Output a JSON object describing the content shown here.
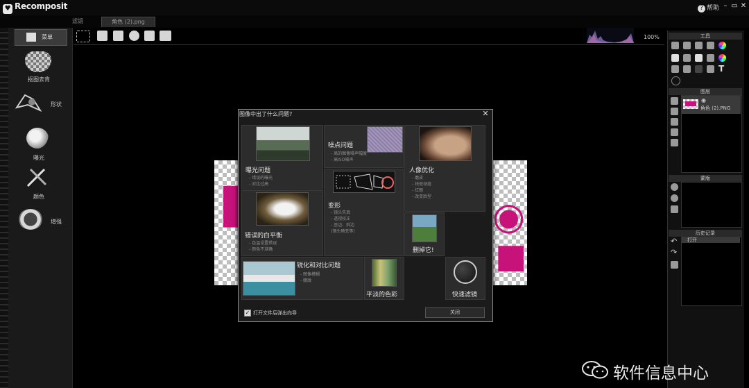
{
  "app": {
    "logo": "Recomposit",
    "help": "帮助",
    "window_controls": [
      "–",
      "▭",
      "✕"
    ]
  },
  "tabs": {
    "filters": "滤镜",
    "file": "角色 (2).png"
  },
  "toolbar": {
    "icons": [
      "zoom-icon",
      "save-icon",
      "export-icon",
      "info-icon",
      "add-image-icon",
      "print-icon"
    ],
    "zoom": "100%"
  },
  "sidebar": {
    "menu": "菜单",
    "items": [
      {
        "label": "抠图去背",
        "icon": "cutout-heart-icon"
      },
      {
        "label": "形状",
        "icon": "shape-icon"
      },
      {
        "label": "曝光",
        "icon": "exposure-icon"
      },
      {
        "label": "颜色",
        "icon": "color-brush-icon"
      },
      {
        "label": "增强",
        "icon": "enhance-icon"
      }
    ]
  },
  "right_panels": {
    "tools": "工具",
    "layers": "图层",
    "layer_name": "角色 (2).PNG",
    "masks": "蒙版",
    "history": "历史记录",
    "history_item": "打开"
  },
  "dialog": {
    "title": "图像中出了什么问题?",
    "close": "✕",
    "cards": {
      "exposure": {
        "title": "曝光问题",
        "items": [
          "- 错误的曝光",
          "- 对比过高"
        ]
      },
      "noise": {
        "title": "噪点问题",
        "items": [
          "- 高的图像噪声幅度",
          "- 高ISO噪声"
        ]
      },
      "portrait": {
        "title": "人像优化",
        "items": [
          "- 磨皮",
          "- 祛斑祛痘",
          "- 红眼",
          "- 改变脸型"
        ]
      },
      "deform": {
        "title": "变形",
        "items": [
          "- 镜头失真",
          "- 透视校正",
          "- 歪边、斜边",
          "(镜头畸变等)"
        ]
      },
      "white_balance": {
        "title": "错误的白平衡",
        "items": [
          "- 色温设置错误",
          "- 颜色不准确"
        ]
      },
      "remove": {
        "title": "删掉它!"
      },
      "sharpen": {
        "title": "锐化和对比问题",
        "items": [
          "- 图像模糊",
          "- 朦胧"
        ]
      },
      "flat_color": {
        "title": "平淡的色彩"
      },
      "quick_filter": {
        "title": "快速滤镜"
      }
    },
    "open_checkbox": "打开文件后弹出向导",
    "close_button": "关闭"
  },
  "watermark": "软件信息中心"
}
